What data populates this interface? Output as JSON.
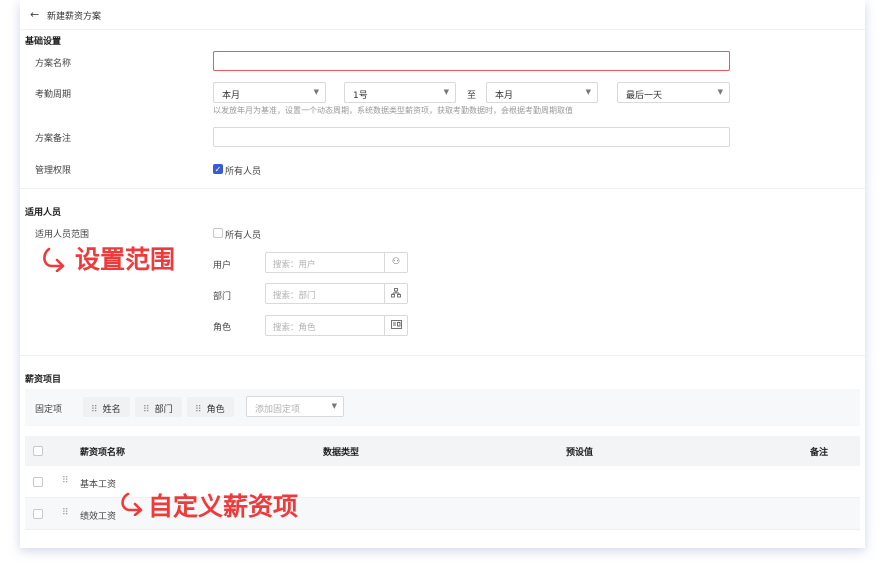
{
  "header": {
    "back_icon": "arrow-left-icon",
    "title": "新建薪资方案"
  },
  "basic": {
    "section_title": "基础设置",
    "name_label": "方案名称",
    "name_value": "",
    "period_label": "考勤周期",
    "period_start_month": "本月",
    "period_start_day": "1号",
    "period_to": "至",
    "period_end_month": "本月",
    "period_end_day": "最后一天",
    "period_hint": "以发放年月为基准，设置一个动态周期，系统数据类型薪资项，获取考勤数据时，会根据考勤周期取值",
    "remark_label": "方案备注",
    "remark_value": "",
    "perm_label": "管理权限",
    "perm_option": "所有人员",
    "perm_checked": true
  },
  "scope": {
    "section_title": "适用人员",
    "range_label": "适用人员范围",
    "all_option": "所有人员",
    "all_checked": false,
    "annotation": "设置范围",
    "user_label": "用户",
    "user_placeholder": "搜索：用户",
    "dept_label": "部门",
    "dept_placeholder": "搜索：部门",
    "role_label": "角色",
    "role_placeholder": "搜索：角色"
  },
  "salary": {
    "section_title": "薪资项目",
    "fixed_label": "固定项",
    "tags": [
      "姓名",
      "部门",
      "角色"
    ],
    "add_placeholder": "添加固定项",
    "columns": [
      "薪资项名称",
      "数据类型",
      "预设值",
      "备注"
    ],
    "rows": [
      {
        "name": "基本工资"
      },
      {
        "name": "绩效工资"
      }
    ],
    "annotation": "自定义薪资项"
  },
  "colors": {
    "accent": "#3a5bd9",
    "error_border": "#f2565f",
    "annotation": "#ee3a3a"
  }
}
